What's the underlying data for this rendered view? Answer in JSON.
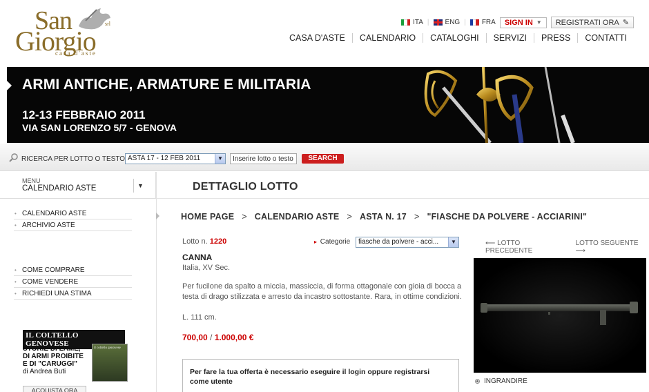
{
  "logo": {
    "line1": "San",
    "line2": "Giorgio",
    "suffix": "srl",
    "tagline": "casa d'aste"
  },
  "languages": [
    {
      "code": "ITA",
      "colors": [
        "#1a9e3a",
        "#ffffff",
        "#d02020"
      ]
    },
    {
      "code": "ENG"
    },
    {
      "code": "FRA",
      "colors": [
        "#1a3aa0",
        "#ffffff",
        "#d02020"
      ]
    }
  ],
  "auth": {
    "sign_in": "SIGN IN",
    "register": "REGISTRATI ORA"
  },
  "nav": [
    "CASA D'ASTE",
    "CALENDARIO",
    "CATALOGHI",
    "SERVIZI",
    "PRESS",
    "CONTATTI"
  ],
  "banner": {
    "title": "ARMI ANTICHE, ARMATURE E MILITARIA",
    "date": "12-13 FEBBRAIO 2011",
    "address": "VIA SAN LORENZO 5/7 - GENOVA"
  },
  "search": {
    "label": "RICERCA PER LOTTO O TESTO",
    "auction_selected": "ASTA 17 - 12 FEB 2011",
    "placeholder": "Inserire lotto o testo",
    "button": "SEARCH"
  },
  "menu": {
    "small_label": "MENU",
    "current": "CALENDARIO ASTE",
    "group1": [
      "CALENDARIO ASTE",
      "ARCHIVIO ASTE"
    ],
    "group2": [
      "COME COMPRARE",
      "COME VENDERE",
      "RICHIEDI UNA STIMA"
    ]
  },
  "promo": {
    "title": "IL COLTELLO GENOVESE",
    "text": "STORIE DI LAME, DI ARMI PROIBITE E DI \"CARUGGI\"",
    "author": "di Andrea Buti",
    "book_cover": "il coltello genovese",
    "button": "ACQUISTA ORA"
  },
  "page": {
    "title": "DETTAGLIO LOTTO",
    "breadcrumb": [
      "HOME PAGE",
      "CALENDARIO ASTE",
      "ASTA N. 17",
      "\"FIASCHE DA POLVERE - ACCIARINI\""
    ]
  },
  "lot": {
    "label": "Lotto n.",
    "number": "1220",
    "category_label": "Categorie",
    "category_value": "fiasche da polvere - acci...",
    "name": "CANNA",
    "origin": "Italia, XV Sec.",
    "description": "Per fucilone da spalto a miccia, massiccia, di forma ottagonale con gioia di bocca a testa di drago stilizzata e arresto da incastro sottostante. Rara, in ottime condizioni.",
    "dimension": "L. 111 cm.",
    "estimate_low": "700,00",
    "estimate_high": "1.000,00 €",
    "login_notice": "Per fare la tua offerta è necessario eseguire il login oppure registrarsi come utente",
    "prev": "LOTTO PRECEDENTE",
    "next": "LOTTO SEGUENTE",
    "enlarge": "INGRANDIRE"
  },
  "colors": {
    "accent_red": "#cc1e1e",
    "gold": "#8a6d2a",
    "banner_bg": "#060606"
  }
}
